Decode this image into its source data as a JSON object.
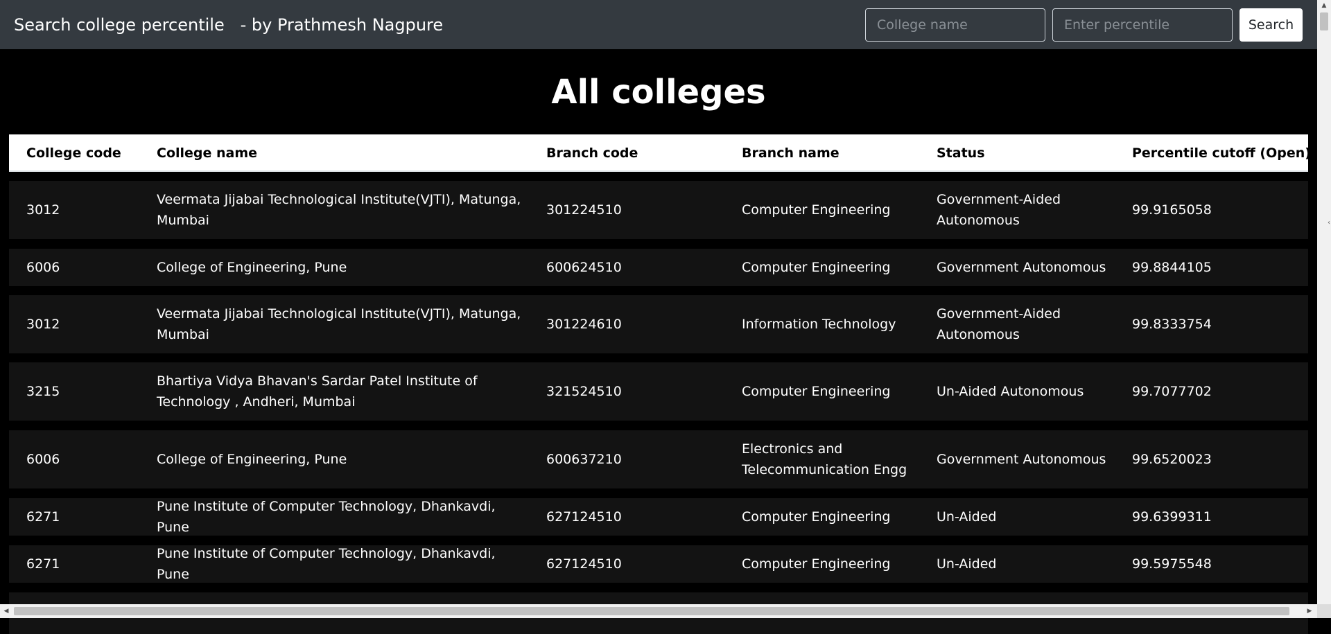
{
  "navbar": {
    "brand": "Search college percentile   - by Prathmesh Nagpure",
    "college_placeholder": "College name",
    "percentile_placeholder": "Enter percentile",
    "search_label": "Search"
  },
  "page_title": "All colleges",
  "table": {
    "headers": [
      "College code",
      "College name",
      "Branch code",
      "Branch name",
      "Status",
      "Percentile cutoff (Open)"
    ],
    "rows": [
      [
        "3012",
        "Veermata Jijabai Technological Institute(VJTI), Matunga, Mumbai",
        "301224510",
        "Computer Engineering",
        "Government-Aided Autonomous",
        "99.9165058"
      ],
      [
        "6006",
        "College of Engineering, Pune",
        "600624510",
        "Computer Engineering",
        "Government Autonomous",
        "99.8844105"
      ],
      [
        "3012",
        "Veermata Jijabai Technological Institute(VJTI), Matunga, Mumbai",
        "301224610",
        "Information Technology",
        "Government-Aided Autonomous",
        "99.8333754"
      ],
      [
        "3215",
        "Bhartiya Vidya Bhavan's Sardar Patel Institute of Technology , Andheri, Mumbai",
        "321524510",
        "Computer Engineering",
        "Un-Aided Autonomous",
        "99.7077702"
      ],
      [
        "6006",
        "College of Engineering, Pune",
        "600637210",
        "Electronics and Telecommunication Engg",
        "Government Autonomous",
        "99.6520023"
      ],
      [
        "6271",
        "Pune Institute of Computer Technology, Dhankavdi, Pune",
        "627124510",
        "Computer Engineering",
        "Un-Aided",
        "99.6399311"
      ],
      [
        "6271",
        "Pune Institute of Computer Technology, Dhankavdi, Pune",
        "627124510",
        "Computer Engineering",
        "Un-Aided",
        "99.5975548"
      ]
    ]
  },
  "colors": {
    "navbar_bg": "#343a40",
    "page_bg": "#000000",
    "row_bg": "#131313",
    "header_bg": "#ffffff"
  }
}
